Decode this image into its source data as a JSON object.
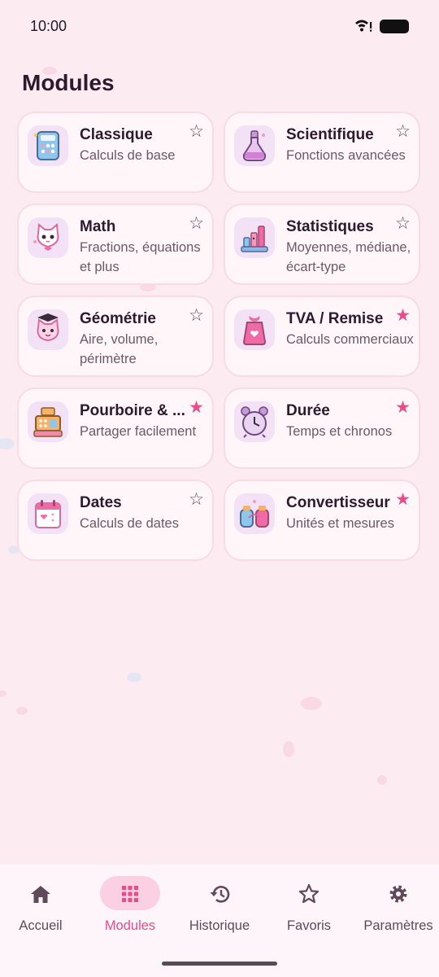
{
  "status_bar": {
    "time": "10:00"
  },
  "page": {
    "title": "Modules"
  },
  "modules": [
    {
      "title": "Classique",
      "desc": "Calculs de base",
      "favorite": false,
      "icon": "calculator-icon"
    },
    {
      "title": "Scientifique",
      "desc": "Fonctions avancées",
      "favorite": false,
      "icon": "potion-flask-icon"
    },
    {
      "title": "Math",
      "desc": "Fractions, équations et plus",
      "favorite": false,
      "icon": "kitten-icon"
    },
    {
      "title": "Statistiques",
      "desc": "Moyennes, médiane, écart-type",
      "favorite": false,
      "icon": "bar-chart-icon"
    },
    {
      "title": "Géométrie",
      "desc": "Aire, volume, périmètre",
      "favorite": false,
      "icon": "graduate-kitten-icon"
    },
    {
      "title": "TVA / Remise",
      "desc": "Calculs commerciaux",
      "favorite": true,
      "icon": "price-tag-icon"
    },
    {
      "title": "Pourboire & ...",
      "desc": "Partager facilement",
      "favorite": true,
      "icon": "cash-register-icon"
    },
    {
      "title": "Durée",
      "desc": "Temps et chronos",
      "favorite": true,
      "icon": "alarm-clock-icon"
    },
    {
      "title": "Dates",
      "desc": "Calculs de dates",
      "favorite": false,
      "icon": "calendar-icon"
    },
    {
      "title": "Convertisseur",
      "desc": "Unités et mesures",
      "favorite": true,
      "icon": "converter-jars-icon"
    }
  ],
  "nav": {
    "items": [
      {
        "label": "Accueil",
        "icon": "home-icon",
        "active": false
      },
      {
        "label": "Modules",
        "icon": "grid-icon",
        "active": true
      },
      {
        "label": "Historique",
        "icon": "history-icon",
        "active": false
      },
      {
        "label": "Favoris",
        "icon": "star-outline-icon",
        "active": false
      },
      {
        "label": "Paramètres",
        "icon": "gear-icon",
        "active": false
      }
    ]
  },
  "colors": {
    "accent": "#ea4c89",
    "background": "#fcecf2",
    "card": "#fff6fa"
  }
}
